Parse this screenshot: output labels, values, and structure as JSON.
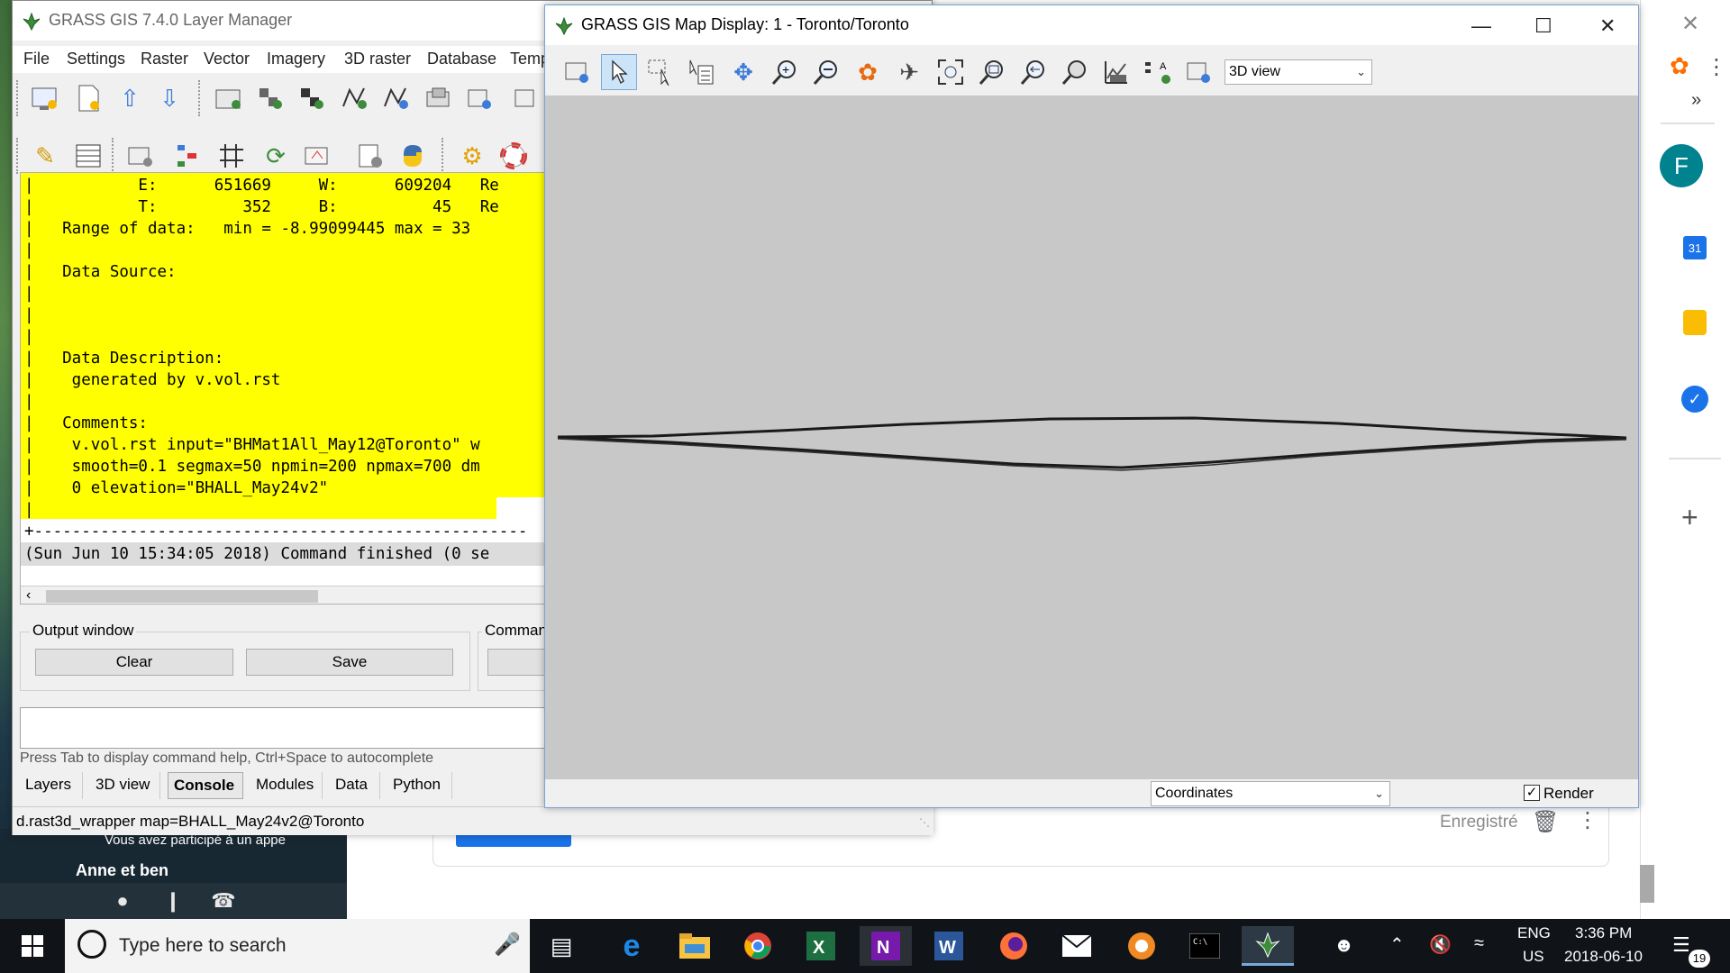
{
  "layer_manager": {
    "title": "GRASS GIS 7.4.0 Layer Manager",
    "menu": [
      "File",
      "Settings",
      "Raster",
      "Vector",
      "Imagery",
      "3D raster",
      "Database",
      "Temp"
    ],
    "console_lines": [
      "|           E:      651669     W:      609204   Re",
      "|           T:         352     B:          45   Re",
      "|   Range of data:   min = -8.99099445 max = 33",
      "|",
      "|   Data Source:",
      "|",
      "|",
      "|",
      "|   Data Description:",
      "|    generated by v.vol.rst",
      "|",
      "|   Comments:",
      "|    v.vol.rst input=\"BHMat1All_May12@Toronto\" w",
      "|    smooth=0.1 segmax=50 npmin=200 npmax=700 dm",
      "|    0 elevation=\"BHALL_May24v2\"",
      "|",
      "+----------------------------------------------------"
    ],
    "finished_line": "(Sun Jun 10 15:34:05 2018) Command finished (0 se",
    "output_window_label": "Output window",
    "clear_label": "Clear",
    "save_label": "Save",
    "command_label": "Comman",
    "cmd_help": "Press Tab to display command help, Ctrl+Space to autocomplete",
    "tabs": [
      "Layers",
      "3D view",
      "Console",
      "Modules",
      "Data",
      "Python"
    ],
    "active_tab": "Console",
    "status": "d.rast3d_wrapper map=BHALL_May24v2@Toronto"
  },
  "map_display": {
    "title": "GRASS GIS Map Display: 1 - Toronto/Toronto",
    "view_select": "3D view",
    "coordinates_select": "Coordinates",
    "render_label": "Render",
    "render_checked": true
  },
  "background": {
    "chat_line1": "Vous avez participé à un appe",
    "chat_name": "Anne et ben",
    "saved_text": "Enregistré",
    "calendar_day": "31",
    "avatar_letter": "F"
  },
  "taskbar": {
    "search_placeholder": "Type here to search",
    "lang_top": "ENG",
    "lang_bottom": "US",
    "time": "3:36 PM",
    "date": "2018-06-10",
    "notification_count": "19"
  },
  "colors": {
    "console_highlight": "#ffff00",
    "map_bg": "#c8c8c8",
    "taskbar": "#101318"
  }
}
